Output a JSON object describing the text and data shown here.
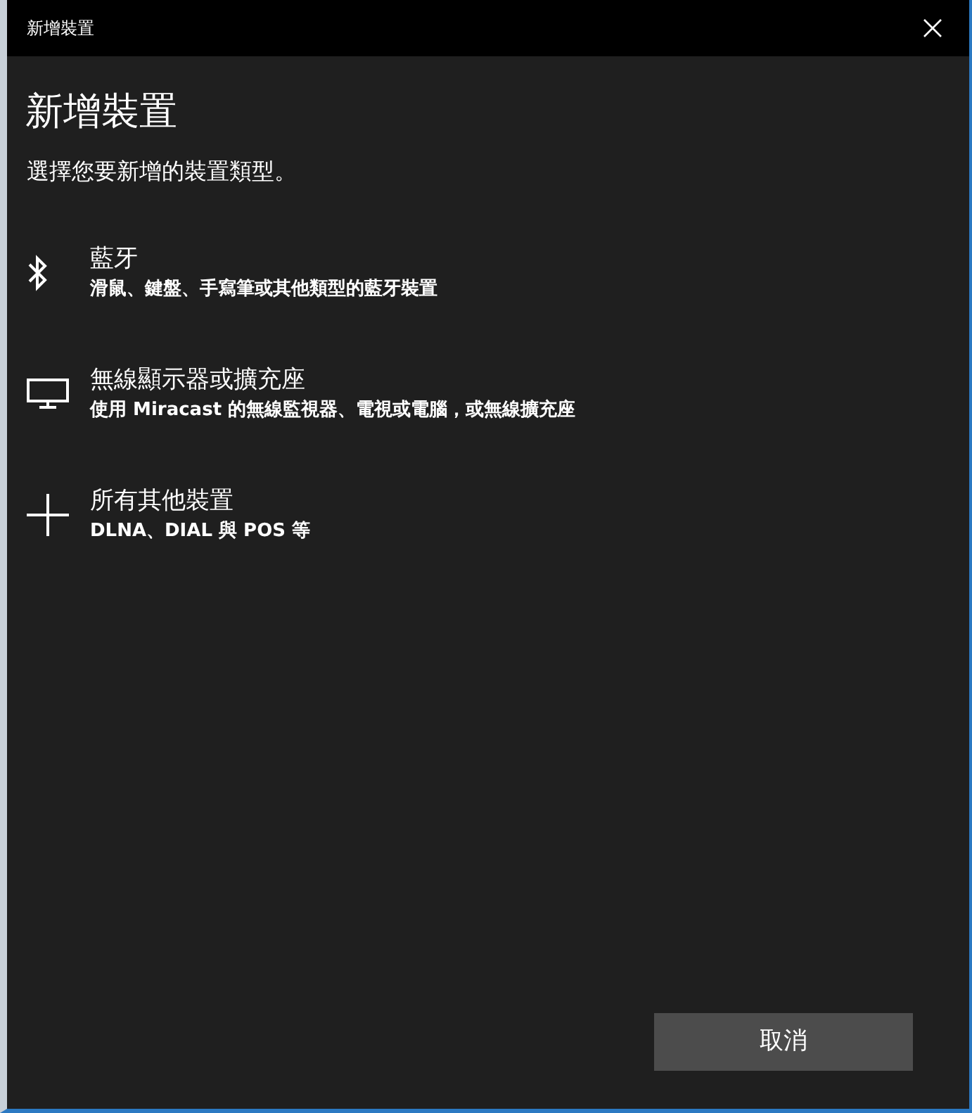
{
  "window": {
    "title": "新增裝置"
  },
  "heading": "新增裝置",
  "prompt": "選擇您要新增的裝置類型。",
  "options": [
    {
      "kind": "bluetooth",
      "title": "藍牙",
      "description": "滑鼠、鍵盤、手寫筆或其他類型的藍牙裝置"
    },
    {
      "kind": "display",
      "title": "無線顯示器或擴充座",
      "description": "使用 Miracast 的無線監視器、電視或電腦，或無線擴充座"
    },
    {
      "kind": "other",
      "title": "所有其他裝置",
      "description": "DLNA、DIAL 與 POS 等"
    }
  ],
  "buttons": [
    {
      "label": "取消"
    }
  ]
}
